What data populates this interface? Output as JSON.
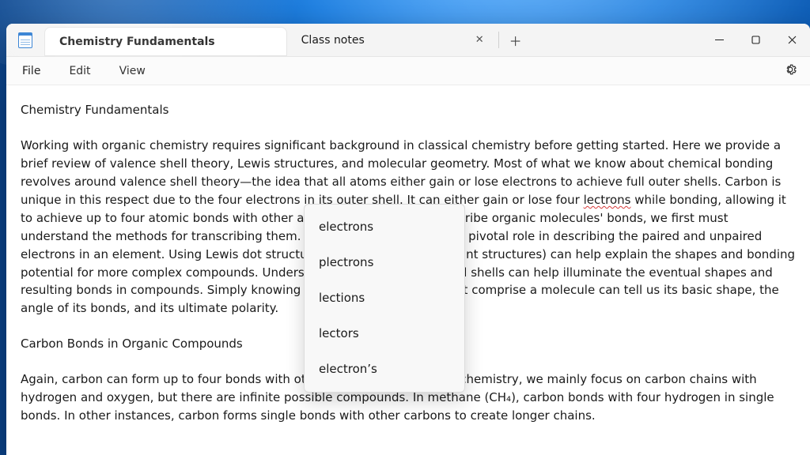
{
  "tabs": [
    {
      "label": "Chemistry Fundamentals",
      "active": true
    },
    {
      "label": "Class notes",
      "active": false
    }
  ],
  "menu": {
    "file": "File",
    "edit": "Edit",
    "view": "View"
  },
  "document": {
    "heading": "Chemistry Fundamentals",
    "para1_a": "Working with organic chemistry requires significant background in classical chemistry before getting started. Here we provide a brief review of valence shell theory, Lewis structures, and molecular geometry. Most of what we know about chemical bonding revolves around valence shell theory—the idea that all atoms either gain or lose electrons to achieve full outer shells. Carbon is unique in this respect due to the four electrons in its outer shell. It can either gain or lose four ",
    "misspelled": "lectrons",
    "para1_b": " while bonding, allowing it to achieve up to four atomic bonds with other atoms or molecules. To describe organic molecules' bonds, we first must understand the methods for transcribing them. Lewis dot structures play a pivotal role in describing the paired and unpaired electrons in an element. Using Lewis dot structures (and examining resonant structures) can help explain the shapes and bonding potential for more complex compounds. Understanding the electron orbital shells can help illuminate the eventual shapes and resulting bonds in compounds. Simply knowing the chemical elements that comprise a molecule can tell us its basic shape, the angle of its bonds, and its ultimate polarity.",
    "subheading": "Carbon Bonds in Organic Compounds",
    "para2": "Again, carbon can form up to four bonds with other molecules. In organic chemistry, we mainly focus on carbon chains with hydrogen and oxygen, but there are infinite possible compounds. In methane (CH₄), carbon bonds with four hydrogen in single bonds. In other instances, carbon forms single bonds with other carbons to create longer chains."
  },
  "suggestions": [
    "electrons",
    "plectrons",
    "lections",
    "lectors",
    "electron’s"
  ]
}
